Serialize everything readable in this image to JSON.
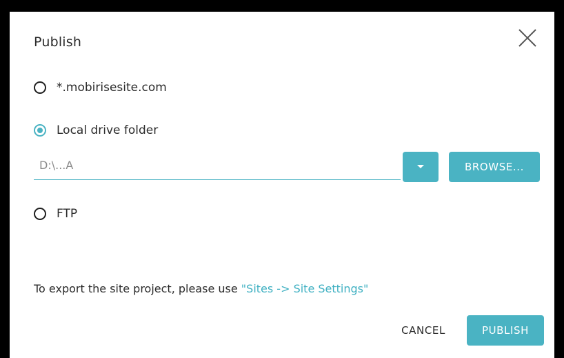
{
  "dialog": {
    "title": "Publish",
    "close_icon": "close-icon"
  },
  "options": {
    "mobirise": {
      "label": "*.mobirisesite.com",
      "selected": false
    },
    "local": {
      "label": "Local drive folder",
      "selected": true
    },
    "ftp": {
      "label": "FTP",
      "selected": false
    }
  },
  "local_folder": {
    "path_value": "D:\\...A",
    "dropdown_icon": "chevron-down-icon",
    "browse_label": "BROWSE..."
  },
  "export_note": {
    "prefix": "To export the site project, please use ",
    "link_text": "\"Sites -> Site Settings\""
  },
  "actions": {
    "cancel_label": "CANCEL",
    "publish_label": "PUBLISH"
  },
  "colors": {
    "accent": "#4ab3c3",
    "text": "#2b2b2b",
    "frame": "#000000"
  }
}
